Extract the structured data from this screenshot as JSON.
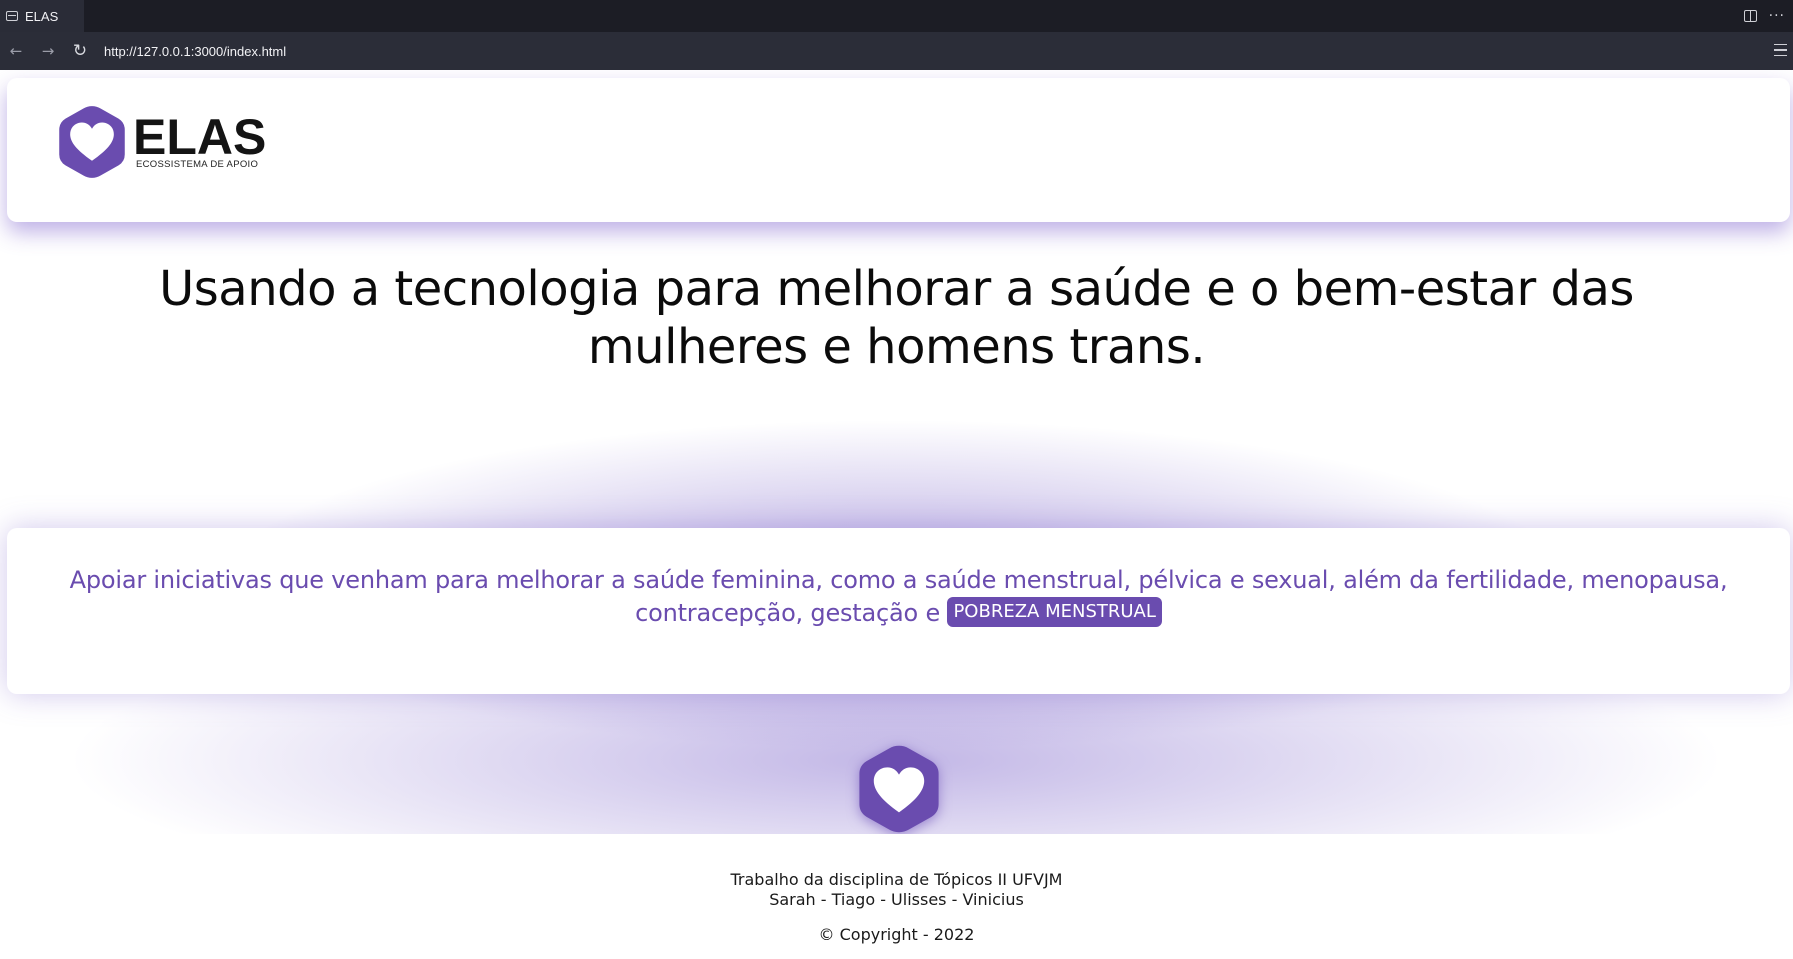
{
  "browser": {
    "tab_title": "ELAS",
    "url": "http://127.0.0.1:3000/index.html",
    "icons": [
      "tab-page-icon",
      "split-view-icon",
      "more-options-icon",
      "back-arrow-icon",
      "forward-arrow-icon",
      "reload-icon",
      "menu-icon"
    ]
  },
  "header": {
    "brand_name": "ELAS",
    "brand_tagline": "ECOSSISTEMA DE APOIO",
    "logo_icon": "heart-hexagon-icon"
  },
  "hero": {
    "line1": "Usando a tecnologia para melhorar a saúde e o bem-estar das",
    "line2": "mulheres e homens trans."
  },
  "mission": {
    "text": "Apoiar iniciativas que venham para melhorar a saúde feminina, como a saúde menstrual, pélvica e sexual, além da fertilidade, menopausa, contracepção, gestação e",
    "badge": "POBREZA MENSTRUAL"
  },
  "footer": {
    "line1": "Trabalho da disciplina de Tópicos II UFVJM",
    "line2": "Sarah - Tiago - Ulisses - Vinicius",
    "copyright": "© Copyright - 2022"
  },
  "colors": {
    "brand_purple": "#6a4caf",
    "chrome_dark": "#1c1d25",
    "chrome_bar": "#2b2d38"
  }
}
